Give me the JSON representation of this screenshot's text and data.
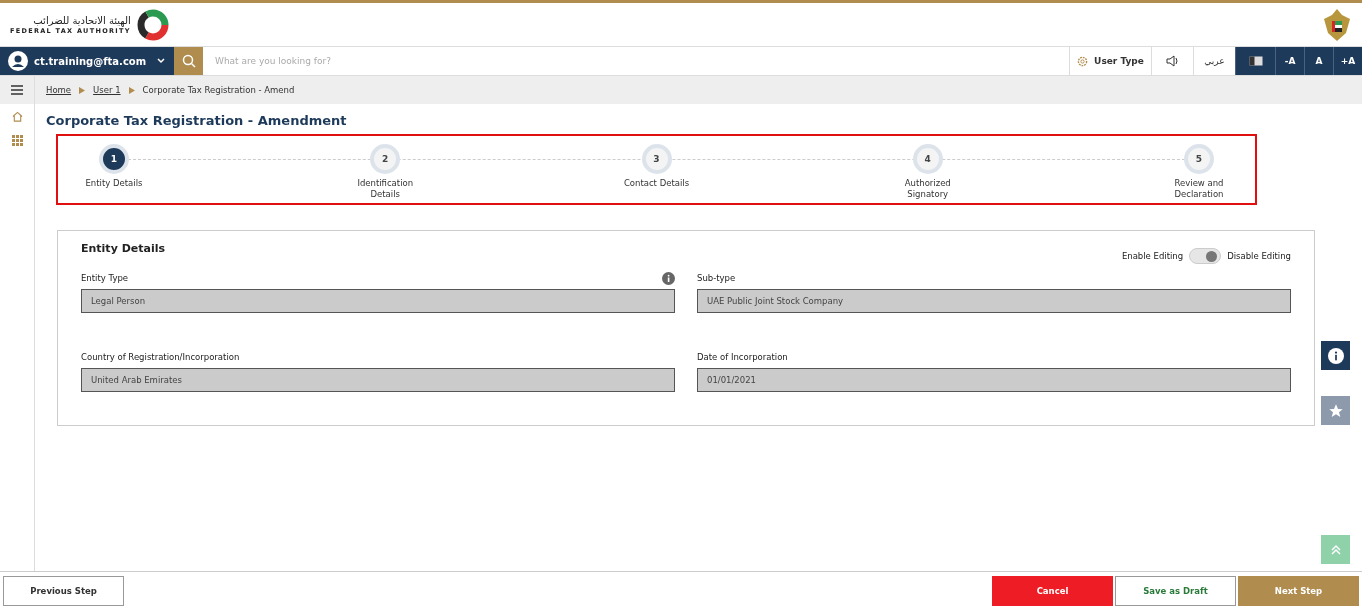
{
  "logo": {
    "arabic": "الهيئة الاتحادية للضرائب",
    "english": "FEDERAL TAX AUTHORITY"
  },
  "nav": {
    "user": "ct.training@fta.com",
    "search_placeholder": "What are you looking for?",
    "user_type": "User Type",
    "language": "عربي",
    "font_buttons": [
      "-A",
      "A",
      "+A"
    ]
  },
  "breadcrumb": [
    {
      "label": "Home",
      "link": true
    },
    {
      "label": "User 1",
      "link": true
    },
    {
      "label": "Corporate Tax Registration - Amend",
      "link": false
    }
  ],
  "page_title": "Corporate Tax Registration - Amendment",
  "steps": [
    {
      "number": "1",
      "label": "Entity Details",
      "selected": true
    },
    {
      "number": "2",
      "label": "Identification Details",
      "selected": false
    },
    {
      "number": "3",
      "label": "Contact Details",
      "selected": false
    },
    {
      "number": "4",
      "label": "Authorized Signatory",
      "selected": false
    },
    {
      "number": "5",
      "label": "Review and Declaration",
      "selected": false
    }
  ],
  "section": {
    "title": "Entity Details",
    "enable_label": "Enable Editing",
    "disable_label": "Disable Editing",
    "disable_editing_on": true,
    "fields": [
      {
        "label": "Entity Type",
        "value": "Legal Person",
        "info": true
      },
      {
        "label": "Sub-type",
        "value": "UAE Public Joint Stock Company",
        "info": false
      },
      {
        "label": "Country of Registration/Incorporation",
        "value": "United Arab Emirates",
        "info": false
      },
      {
        "label": "Date of Incorporation",
        "value": "01/01/2021",
        "info": false
      }
    ]
  },
  "footer": {
    "previous": "Previous Step",
    "cancel": "Cancel",
    "draft": "Save as Draft",
    "next": "Next Step"
  }
}
